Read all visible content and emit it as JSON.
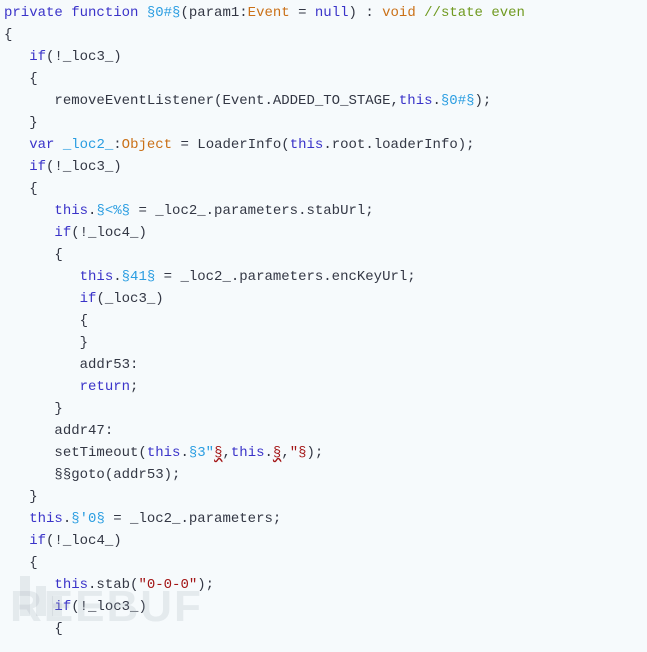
{
  "code": {
    "l1": {
      "k1": "private",
      "k2": "function",
      "n1": "§0#§",
      "p": "(param1:",
      "t1": "Event",
      "p2": " = ",
      "k3": "null",
      "p3": ") : ",
      "t2": "void",
      "c": " //state even"
    },
    "l2": {
      "t": "{"
    },
    "l3": {
      "k": "if",
      "e": "(!_loc3_)"
    },
    "l4": {
      "t": "{"
    },
    "l5": {
      "e": "removeEventListener(Event.ADDED_TO_STAGE,",
      "k": "this",
      "e2": ".",
      "n": "§0#§",
      "e3": ");"
    },
    "l6": {
      "t": "}"
    },
    "l7": {
      "k": "var",
      "n": "_loc2_",
      "e": ":",
      "t2": "Object",
      "e2": " = LoaderInfo(",
      "k2": "this",
      "e3": ".root.loaderInfo);"
    },
    "l8": {
      "k": "if",
      "e": "(!_loc3_)"
    },
    "l9": {
      "t": "{"
    },
    "l10": {
      "k": "this",
      "e": ".",
      "n": "§<%§",
      "e2": " = _loc2_.parameters.stabUrl;"
    },
    "l11": {
      "k": "if",
      "e": "(!_loc4_)"
    },
    "l12": {
      "t": "{"
    },
    "l13": {
      "k": "this",
      "e": ".",
      "n": "§41§",
      "e2": " = _loc2_.parameters.encKeyUrl;"
    },
    "l14": {
      "k": "if",
      "e": "(_loc3_)"
    },
    "l15": {
      "t": "{"
    },
    "l16": {
      "t": "}"
    },
    "l17": {
      "e": "addr53:"
    },
    "l18": {
      "k": "return",
      "e": ";"
    },
    "l19": {
      "t": "}"
    },
    "l20": {
      "e": "addr47:"
    },
    "l21": {
      "e": "setTimeout(",
      "k": "this",
      "e2": ".",
      "n": "§3\"",
      "w": "§",
      "e3": ",",
      "k2": "this",
      "e4": ".",
      "w2": "§",
      "e5": ",",
      "s": "\"§",
      "e6": ");"
    },
    "l22": {
      "e": "§§goto(addr53);"
    },
    "l23": {
      "t": "}"
    },
    "l24": {
      "k": "this",
      "e": ".",
      "n": "§'0§",
      "e2": " = _loc2_.parameters;"
    },
    "l25": {
      "k": "if",
      "e": "(!_loc4_)"
    },
    "l26": {
      "t": "{"
    },
    "l27": {
      "k": "this",
      "e": ".stab(",
      "s": "\"0-0-0\"",
      "e2": ");"
    },
    "l28": {
      "k": "if",
      "e": "(!_loc3_)"
    },
    "l29": {
      "t": "{"
    }
  },
  "watermark": "REEBUF"
}
